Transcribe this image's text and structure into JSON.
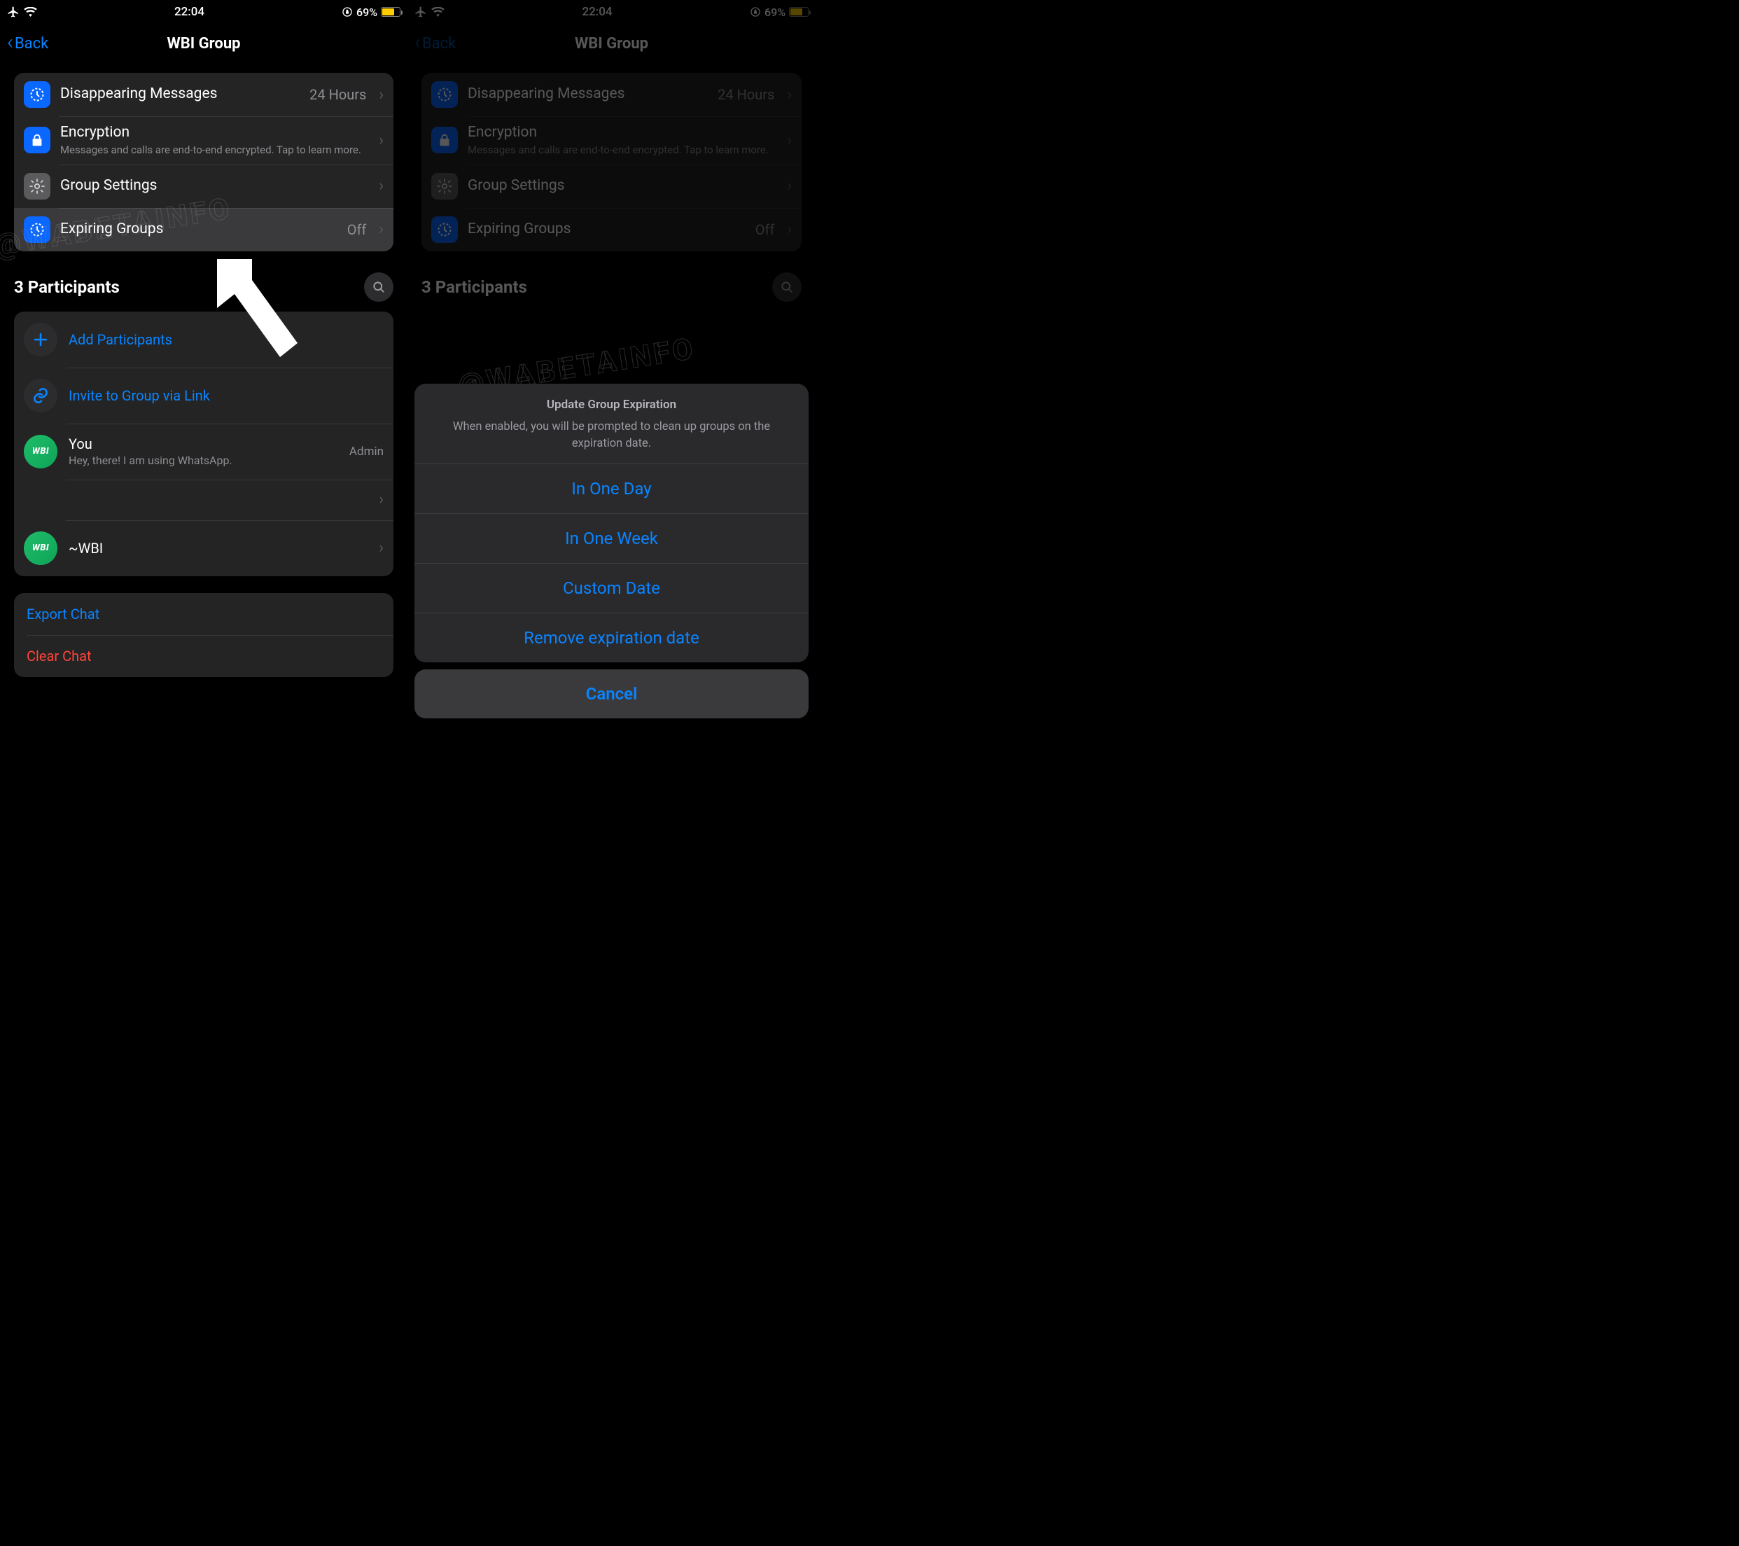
{
  "status": {
    "time": "22:04",
    "battery_pct": "69%"
  },
  "nav": {
    "back": "Back",
    "title": "WBI Group"
  },
  "settings": {
    "disappearing": {
      "label": "Disappearing Messages",
      "value": "24 Hours"
    },
    "encryption": {
      "label": "Encryption",
      "sub": "Messages and calls are end-to-end encrypted. Tap to learn more."
    },
    "group_settings": {
      "label": "Group Settings"
    },
    "expiring": {
      "label": "Expiring Groups",
      "value": "Off"
    }
  },
  "participants": {
    "header": "3 Participants",
    "add": "Add Participants",
    "invite": "Invite to Group via Link",
    "you": {
      "name": "You",
      "status": "Hey, there! I am using WhatsApp.",
      "role": "Admin"
    },
    "wbi": {
      "name": "~WBI"
    },
    "avatar_text": "WBI"
  },
  "footer": {
    "export": "Export Chat",
    "clear": "Clear Chat"
  },
  "sheet": {
    "title": "Update Group Expiration",
    "desc": "When enabled, you will be prompted to clean up groups on the expiration date.",
    "opt1": "In One Day",
    "opt2": "In One Week",
    "opt3": "Custom Date",
    "opt4": "Remove expiration date",
    "cancel": "Cancel"
  },
  "watermark": "@WABETAINFO"
}
